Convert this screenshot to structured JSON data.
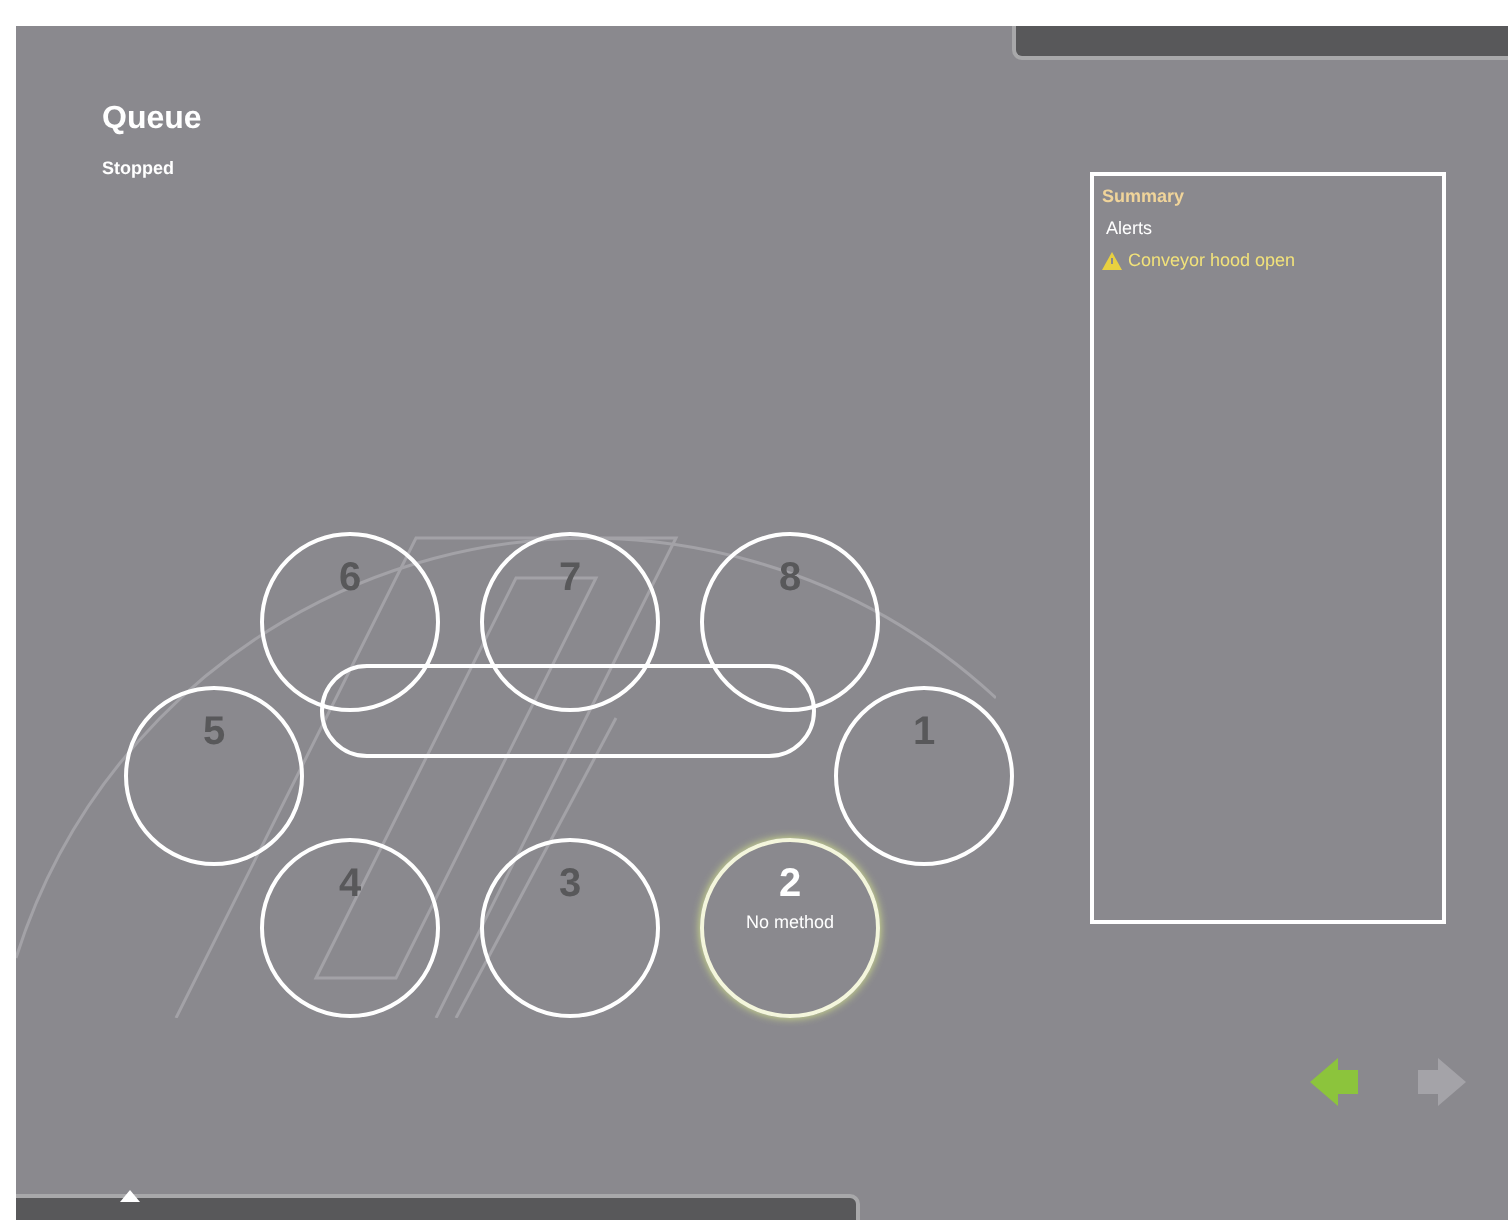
{
  "title": "Queue",
  "status": "Stopped",
  "stations": [
    {
      "number": "6",
      "selected": false
    },
    {
      "number": "7",
      "selected": false
    },
    {
      "number": "8",
      "selected": false
    },
    {
      "number": "5",
      "selected": false
    },
    {
      "number": "1",
      "selected": false
    },
    {
      "number": "4",
      "selected": false
    },
    {
      "number": "3",
      "selected": false
    },
    {
      "number": "2",
      "selected": true,
      "method": "No method"
    }
  ],
  "summary": {
    "title": "Summary",
    "section": "Alerts",
    "alerts": [
      {
        "text": "Conveyor hood open"
      }
    ]
  },
  "navigation": [
    {
      "kind": "back",
      "disabled": false
    },
    {
      "kind": "forward",
      "disabled": true
    }
  ]
}
